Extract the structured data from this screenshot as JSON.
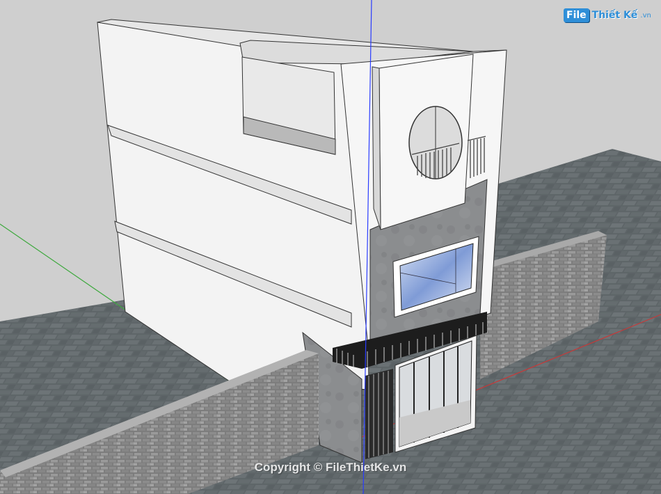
{
  "logo": {
    "badge": "File",
    "name": "Thiết Kế",
    "tld": ".vn"
  },
  "watermark": "Copyright © FileThietKe.vn",
  "colors": {
    "sky": "#cfcfcf",
    "ground": "#5c6366",
    "wall_white": "#f4f4f4",
    "concrete": "#8a8c8e",
    "brick": "#8f8f8f",
    "glass": "#8aa6d8",
    "axis_blue": "#2a3cff",
    "axis_green": "#3fa93f",
    "axis_red": "#c43a3a"
  }
}
